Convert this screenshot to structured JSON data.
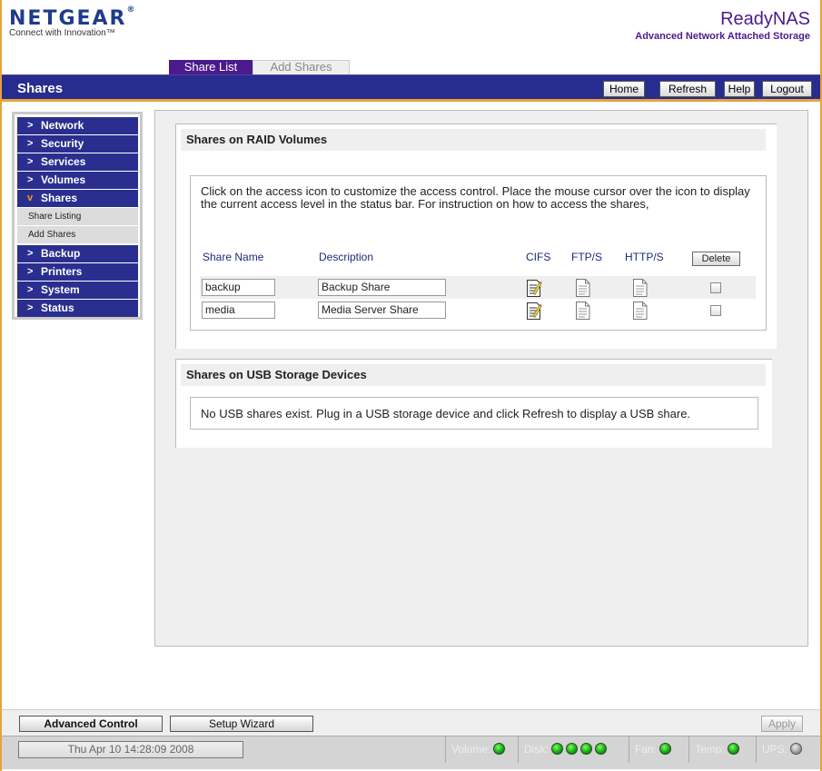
{
  "header": {
    "brand": "NETGEAR",
    "brand_mark": "®",
    "tagline": "Connect with Innovation™",
    "product_name": "ReadyNAS",
    "product_subtitle": "Advanced Network Attached Storage"
  },
  "tabs": [
    {
      "label": "Share List",
      "active": true
    },
    {
      "label": "Add Shares",
      "active": false
    }
  ],
  "titlebar": {
    "title": "Shares",
    "buttons": {
      "home": "Home",
      "refresh": "Refresh",
      "help": "Help",
      "logout": "Logout"
    }
  },
  "sidebar": {
    "items": [
      {
        "label": "Network",
        "icon": "chevron-right-icon"
      },
      {
        "label": "Security",
        "icon": "chevron-right-icon"
      },
      {
        "label": "Services",
        "icon": "chevron-right-icon"
      },
      {
        "label": "Volumes",
        "icon": "chevron-right-icon"
      },
      {
        "label": "Shares",
        "icon": "chevron-down-icon",
        "expanded": true
      },
      {
        "label": "Backup",
        "icon": "chevron-right-icon"
      },
      {
        "label": "Printers",
        "icon": "chevron-right-icon"
      },
      {
        "label": "System",
        "icon": "chevron-right-icon"
      },
      {
        "label": "Status",
        "icon": "chevron-right-icon"
      }
    ],
    "subitems": [
      "Share Listing",
      "Add Shares"
    ]
  },
  "raid": {
    "heading": "Shares on RAID Volumes",
    "instructions": "Click on the access icon to customize the access control. Place the mouse cursor over the icon to display the current access level in the status bar. For instruction on how to access the shares,",
    "columns": {
      "name": "Share Name",
      "description": "Description",
      "cifs": "CIFS",
      "ftp": "FTP/S",
      "http": "HTTP/S",
      "delete": "Delete"
    },
    "rows": [
      {
        "name": "backup",
        "description": "Backup Share",
        "cifs_icon": "document-edit-icon",
        "ftp_icon": "document-icon",
        "http_icon": "document-icon",
        "delete_checked": false
      },
      {
        "name": "media",
        "description": "Media Server Share",
        "cifs_icon": "document-edit-icon",
        "ftp_icon": "document-icon",
        "http_icon": "document-icon",
        "delete_checked": false
      }
    ]
  },
  "usb": {
    "heading": "Shares on USB Storage Devices",
    "message": "No USB shares exist. Plug in a USB storage device and click Refresh to display a USB share."
  },
  "actionbar": {
    "advanced_control": "Advanced Control",
    "setup_wizard": "Setup Wizard",
    "apply": "Apply"
  },
  "statusbar": {
    "datetime": "Thu Apr 10  14:28:09 2008",
    "volume_label": "Volume:",
    "disk_label": "Disk:",
    "fan_label": "Fan:",
    "temp_label": "Temp:",
    "ups_label": "UPS:",
    "volume_status": "green",
    "disk_status": [
      "green",
      "green",
      "green",
      "green"
    ],
    "fan_status": "green",
    "temp_status": "green",
    "ups_status": "grey"
  },
  "colors": {
    "brand_blue": "#1f3b8c",
    "product_purple": "#4b1a8c",
    "titlebar": "#262d8e",
    "accent_orange": "#e8a23a",
    "status_green": "#10a010"
  }
}
